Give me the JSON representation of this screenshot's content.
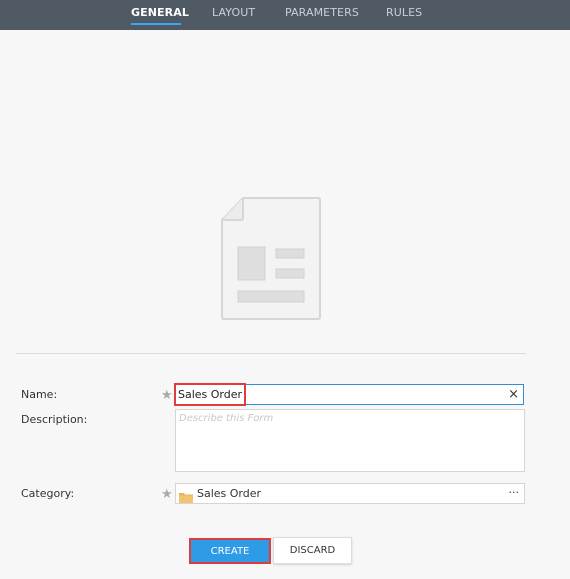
{
  "tabs": [
    {
      "label": "GENERAL",
      "active": true
    },
    {
      "label": "LAYOUT",
      "active": false
    },
    {
      "label": "PARAMETERS",
      "active": false
    },
    {
      "label": "RULES",
      "active": false
    }
  ],
  "form": {
    "name_label": "Name:",
    "name_value": "Sales Order",
    "description_label": "Description:",
    "description_placeholder": "Describe this Form",
    "category_label": "Category:",
    "category_value": "Sales Order",
    "category_more": "···",
    "required_marker": "★",
    "clear_glyph": "×"
  },
  "buttons": {
    "create": "CREATE",
    "discard": "DISCARD"
  },
  "icons": {
    "illustration": "form-document-icon",
    "folder": "folder-icon",
    "clear": "close-icon"
  },
  "colors": {
    "topbar": "#4f5a64",
    "accent": "#2d9be6",
    "highlight": "#e03c3c"
  }
}
